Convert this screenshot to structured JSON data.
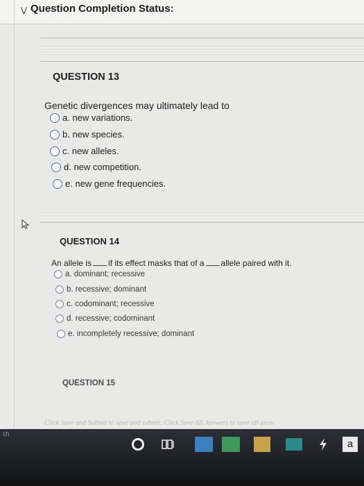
{
  "status": {
    "title": "Question Completion Status:"
  },
  "q13": {
    "heading": "QUESTION 13",
    "text": "Genetic divergences may ultimately lead to",
    "choices": [
      "a. new variations.",
      "b. new species.",
      "c. new alleles.",
      "d. new competition.",
      "e. new gene frequencies."
    ]
  },
  "q14": {
    "heading": "QUESTION 14",
    "text_part1": "An allele is",
    "text_part2": "if its effect masks that of a",
    "text_part3": "allele paired with it.",
    "choices": [
      "a. dominant; recessive",
      "b. recessive; dominant",
      "c. codominant; recessive",
      "d. recessive; codominant",
      "e. incompletely recessive; dominant"
    ]
  },
  "q15": {
    "heading": "QUESTION 15"
  },
  "footer": {
    "text": "Click Save and Submit to save and submit. Click Save All Answers to save all answ"
  },
  "taskbar": {
    "lang": "ch",
    "amazon_letter": "a"
  },
  "icons": {
    "chevron": "chevron-down-icon",
    "cursor": "mouse-pointer-icon"
  }
}
